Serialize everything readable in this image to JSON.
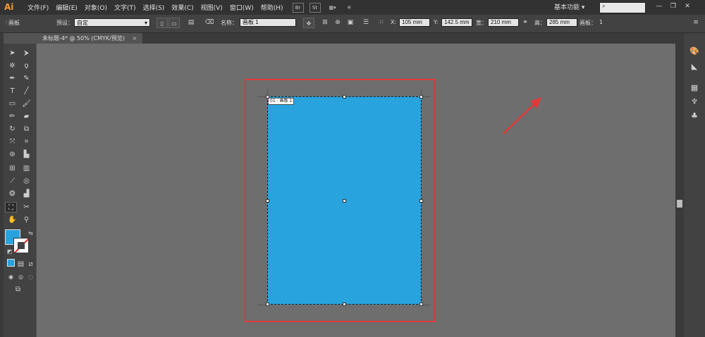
{
  "app": {
    "logo": "Ai"
  },
  "menu": [
    "文件(F)",
    "编辑(E)",
    "对象(O)",
    "文字(T)",
    "选择(S)",
    "效果(C)",
    "视图(V)",
    "窗口(W)",
    "帮助(H)"
  ],
  "menubar_icons": {
    "bridge": "Br",
    "stock": "St"
  },
  "workspace": {
    "label": "基本功能",
    "arrow": "▾"
  },
  "search": {
    "placeholder": "",
    "icon": "⌕"
  },
  "window_controls": {
    "minimize": "—",
    "restore": "❐",
    "close": "✕"
  },
  "control": {
    "panel_label": "画板",
    "preset_label": "预设：",
    "preset_value": "自定",
    "name_label": "名称：",
    "name_value": "画板 1",
    "x_label": "X:",
    "x_value": "105 mm",
    "y_label": "Y:",
    "y_value": "142.5 mm",
    "width_label": "宽：",
    "width_value": "210 mm",
    "height_label": "高：",
    "height_value": "285 mm",
    "artboards_label": "画板：",
    "artboards_value": "1",
    "menu_glyph": "≡"
  },
  "document_tab": {
    "title": "未标题-4* @ 50% (CMYK/预览)",
    "close": "×"
  },
  "artboard": {
    "label": "01 - 画板 1",
    "fill_color": "#29a3de"
  },
  "highlight_color": "#e0393a",
  "colors": {
    "fill": "#29a3de",
    "stroke": "none"
  }
}
